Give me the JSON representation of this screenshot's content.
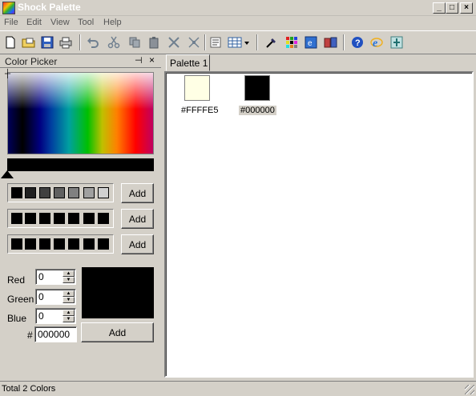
{
  "window": {
    "title": "Shock Palette",
    "minimize": "_",
    "maximize": "□",
    "close": "×"
  },
  "menu": [
    "File",
    "Edit",
    "View",
    "Tool",
    "Help"
  ],
  "toolbar": {
    "icons": [
      "new-icon",
      "open-icon",
      "save-icon",
      "print-icon",
      "undo-icon",
      "cut-icon",
      "copy-icon",
      "paste-icon",
      "delete-icon",
      "merge-icon",
      "list-view-icon",
      "grid-view-icon",
      "eyedropper-icon",
      "color-table-icon",
      "web-export-icon",
      "library-icon",
      "help-icon",
      "ie-icon",
      "about-icon"
    ]
  },
  "color_picker": {
    "title": "Color Picker",
    "pin": "⊣",
    "close": "×",
    "swatch_rows": [
      {
        "colors": [
          "#000000",
          "#202020",
          "#404040",
          "#606060",
          "#808080",
          "#a0a0a0",
          "#d0d0d0"
        ],
        "add_label": "Add"
      },
      {
        "colors": [
          "#000000",
          "#000000",
          "#000000",
          "#000000",
          "#000000",
          "#000000",
          "#000000"
        ],
        "add_label": "Add"
      },
      {
        "colors": [
          "#000000",
          "#000000",
          "#000000",
          "#000000",
          "#000000",
          "#000000",
          "#000000"
        ],
        "add_label": "Add"
      }
    ],
    "red_label": "Red",
    "green_label": "Green",
    "blue_label": "Blue",
    "hash_label": "#",
    "red": "0",
    "green": "0",
    "blue": "0",
    "hex": "000000",
    "add_label": "Add",
    "preview_color": "#000000"
  },
  "tabs": [
    "Palette 1"
  ],
  "palette": [
    {
      "color": "#FFFFE5",
      "label": "#FFFFE5",
      "selected": false
    },
    {
      "color": "#000000",
      "label": "#000000",
      "selected": true
    }
  ],
  "status": "Total 2 Colors"
}
